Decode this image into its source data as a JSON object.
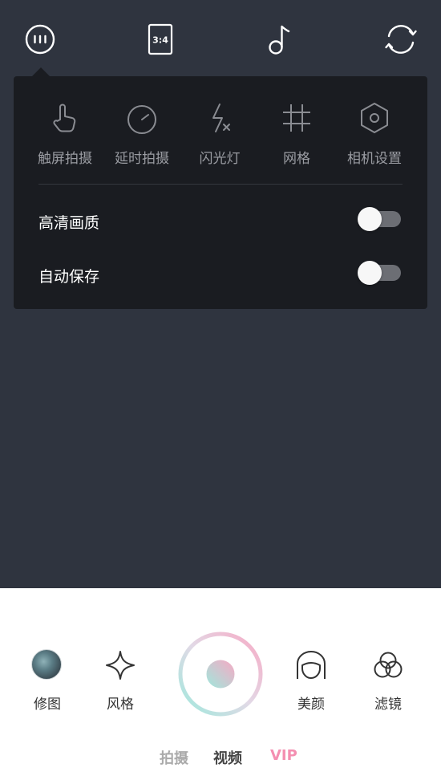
{
  "topbar": {
    "more_icon": "more-icon",
    "ratio_label": "3:4",
    "music_icon": "music-note-icon",
    "switch_icon": "camera-switch-icon"
  },
  "panel": {
    "tools": [
      {
        "icon": "touch-hand-icon",
        "label": "触屏拍摄"
      },
      {
        "icon": "timer-icon",
        "label": "延时拍摄"
      },
      {
        "icon": "flash-off-icon",
        "label": "闪光灯"
      },
      {
        "icon": "grid-icon",
        "label": "网格"
      },
      {
        "icon": "settings-hexagon-icon",
        "label": "相机设置"
      }
    ],
    "settings": [
      {
        "label": "高清画质",
        "on": false
      },
      {
        "label": "自动保存",
        "on": false
      }
    ]
  },
  "bottom": {
    "left_items": [
      {
        "icon": "photo-thumbnail",
        "label": "修图"
      },
      {
        "icon": "sparkle-icon",
        "label": "风格"
      }
    ],
    "right_items": [
      {
        "icon": "face-beauty-icon",
        "label": "美颜"
      },
      {
        "icon": "filter-circles-icon",
        "label": "滤镜"
      }
    ],
    "modes": [
      {
        "label": "拍摄",
        "state": "inactive"
      },
      {
        "label": "视频",
        "state": "active"
      },
      {
        "label": "VIP",
        "state": "vip"
      }
    ]
  },
  "colors": {
    "background": "#2f343f",
    "panel": "#1a1c21",
    "toggle_track": "#6c6e74",
    "shutter_pink": "#f7a9c4",
    "shutter_mint": "#9fe8dc",
    "vip": "#f48fb1",
    "mode_inactive": "#aaaaaa",
    "mode_active": "#444444"
  }
}
